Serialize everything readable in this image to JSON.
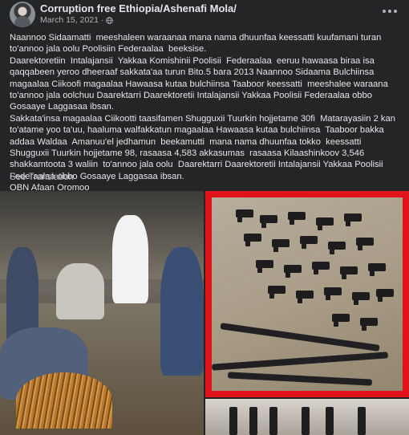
{
  "post": {
    "author": "Corruption free Ethiopia/Ashenafi Mola/",
    "date": "March 15, 2021",
    "separator": "·",
    "paragraphs": [
      "Naannoo Sidaamatti  meeshaleen waraanaa mana nama dhuunfaa keessatti kuufamani turan to'annoo jala oolu Poolisiin Federaalaa  beeksise.",
      "Daarektoretiin  Intalajansii  Yakkaa Komishinii Poolisii  Federaalaa  eeruu hawaasa biraa isa qaqqabeen yeroo dheeraaf sakkata'aa turun Bito.5 bara 2013 Naannoo Sidaama Bulchiinsa magaalaa Ciikoofi magaalaa Hawaasa kutaa bulchiinsa Taaboor keessatti  meeshalee waraana  to'annoo jala oolchuu Daarektarri Daarektoretii Intalajansii Yakkaa Poolisii Federaalaa obbo Gosaaye Laggasaa ibsan.",
      "Sakkata'insa magaalaa Ciikootti taasifamen Shugguxii Tuurkin hojjetame 30fi  Matarayasiin 2 kan to'atame yoo ta'uu, haaluma walfakkatun magaalaa Hawaasa kutaa bulchiinsa  Taaboor bakka addaa Waldaa  Amanuu'el jedhamun  beekamutti  mana nama dhuunfaa tokko  keessatti Shugguxii Tuurkin hojjetame 98, rasaasa 4,583 akkasumas  rasaasa Kilaashinkoov 3,546 shakkamtoota 3 waliin  to'annoo jala oolu  Daarektarri Daarektoretii Intalajansii Yakkaa Poolisii Federaalaa obbo Gosaaye Laggasaa ibsan.",
      "OBN Afaan Oromoo"
    ],
    "see_translation": "See Translation",
    "icons": {
      "privacy": "globe-icon",
      "more": "more-options-icon"
    },
    "highlight_color": "#e0121a",
    "background_color": "#242526"
  }
}
